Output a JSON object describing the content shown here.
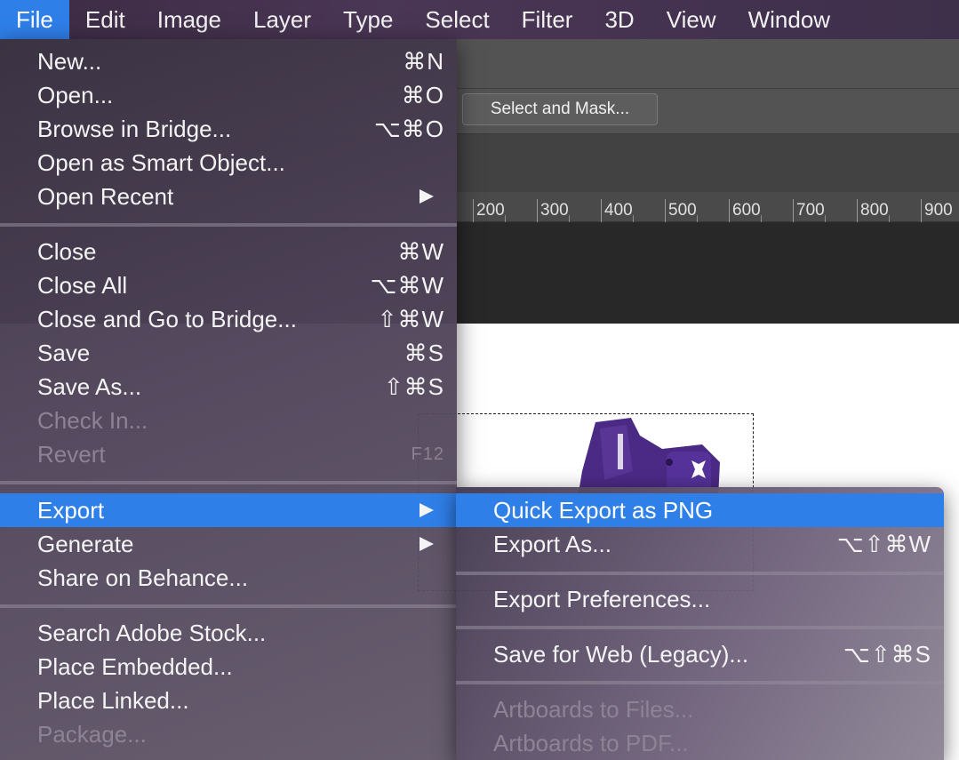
{
  "menubar": {
    "items": [
      "File",
      "Edit",
      "Image",
      "Layer",
      "Type",
      "Select",
      "Filter",
      "3D",
      "View",
      "Window"
    ]
  },
  "options_bar": {
    "select_and_mask_label": "Select and Mask..."
  },
  "ruler": {
    "labels": [
      "200",
      "300",
      "400",
      "500",
      "600",
      "700",
      "800",
      "900"
    ]
  },
  "file_menu": {
    "items": [
      {
        "label": "New...",
        "shortcut": "⌘N"
      },
      {
        "label": "Open...",
        "shortcut": "⌘O"
      },
      {
        "label": "Browse in Bridge...",
        "shortcut": "⌥⌘O"
      },
      {
        "label": "Open as Smart Object...",
        "shortcut": ""
      },
      {
        "label": "Open Recent",
        "shortcut": ""
      },
      {
        "label": "Close",
        "shortcut": "⌘W"
      },
      {
        "label": "Close All",
        "shortcut": "⌥⌘W"
      },
      {
        "label": "Close and Go to Bridge...",
        "shortcut": "⇧⌘W"
      },
      {
        "label": "Save",
        "shortcut": "⌘S"
      },
      {
        "label": "Save As...",
        "shortcut": "⇧⌘S"
      },
      {
        "label": "Check In...",
        "shortcut": ""
      },
      {
        "label": "Revert",
        "shortcut": "F12"
      },
      {
        "label": "Export",
        "shortcut": ""
      },
      {
        "label": "Generate",
        "shortcut": ""
      },
      {
        "label": "Share on Behance...",
        "shortcut": ""
      },
      {
        "label": "Search Adobe Stock...",
        "shortcut": ""
      },
      {
        "label": "Place Embedded...",
        "shortcut": ""
      },
      {
        "label": "Place Linked...",
        "shortcut": ""
      },
      {
        "label": "Package...",
        "shortcut": ""
      }
    ]
  },
  "export_menu": {
    "items": [
      {
        "label": "Quick Export as PNG",
        "shortcut": ""
      },
      {
        "label": "Export As...",
        "shortcut": "⌥⇧⌘W"
      },
      {
        "label": "Export Preferences...",
        "shortcut": ""
      },
      {
        "label": "Save for Web (Legacy)...",
        "shortcut": "⌥⇧⌘S"
      },
      {
        "label": "Artboards to Files...",
        "shortcut": ""
      },
      {
        "label": "Artboards to PDF...",
        "shortcut": ""
      }
    ]
  },
  "colors": {
    "highlight": "#2f7fe9",
    "product_purple": "#4b2a86"
  }
}
